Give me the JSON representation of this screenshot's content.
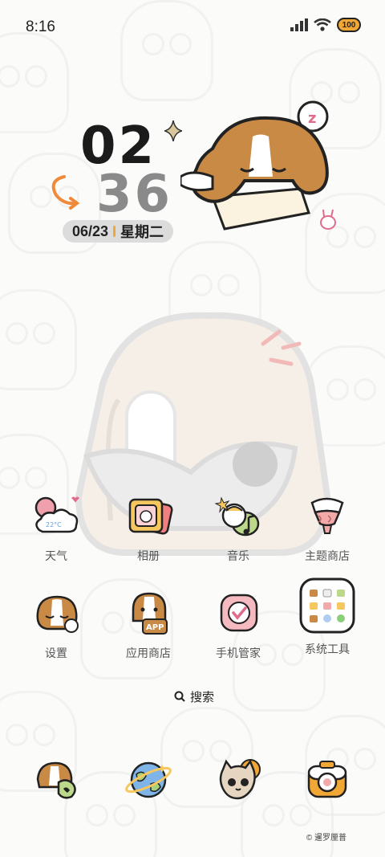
{
  "status_bar": {
    "time": "8:16",
    "battery": "100"
  },
  "clock": {
    "hour": "02",
    "minute": "36",
    "date": "06/23",
    "weekday": "星期二"
  },
  "apps_row1": [
    {
      "label": "天气",
      "icon": "weather-icon",
      "temp": "22°C"
    },
    {
      "label": "相册",
      "icon": "gallery-icon"
    },
    {
      "label": "音乐",
      "icon": "music-icon"
    },
    {
      "label": "主题商店",
      "icon": "theme-store-icon"
    }
  ],
  "apps_row2": [
    {
      "label": "设置",
      "icon": "settings-icon"
    },
    {
      "label": "应用商店",
      "icon": "app-store-icon",
      "badge": "APP"
    },
    {
      "label": "手机管家",
      "icon": "phone-manager-icon"
    },
    {
      "label": "系统工具",
      "icon": "system-tools-folder-icon"
    }
  ],
  "search": {
    "label": "搜索"
  },
  "dock": [
    {
      "icon": "phone-icon"
    },
    {
      "icon": "browser-icon"
    },
    {
      "icon": "messages-icon"
    },
    {
      "icon": "camera-icon"
    }
  ],
  "copyright": "© 暹罗厘普",
  "colors": {
    "accent": "#f0a736",
    "dog_brown": "#c98a45",
    "pink": "#f0a0ad"
  }
}
